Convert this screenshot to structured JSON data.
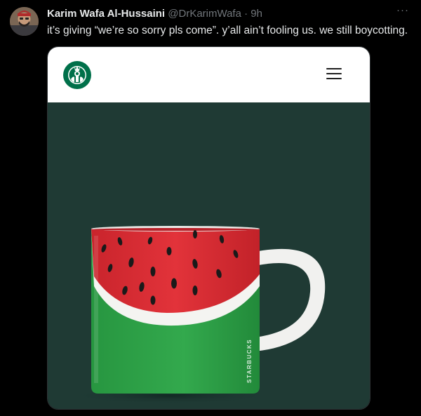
{
  "tweet": {
    "author_name": "Karim Wafa Al-Hussaini",
    "author_handle": "@DrKarimWafa",
    "separator": "·",
    "timestamp": "9h",
    "more_label": "···",
    "text": "it’s giving “we’re so sorry pls come”. y’all ain’t fooling us. we still boycotting."
  },
  "media": {
    "brand_colors": {
      "starbucks_green": "#00704a",
      "background": "#1f3a34",
      "watermelon_red": "#d92b33",
      "rind_green": "#2e9e48"
    },
    "mug_label": "STARBUCKS",
    "logo_icon": "starbucks-siren-logo",
    "menu_icon": "hamburger-menu-icon"
  }
}
